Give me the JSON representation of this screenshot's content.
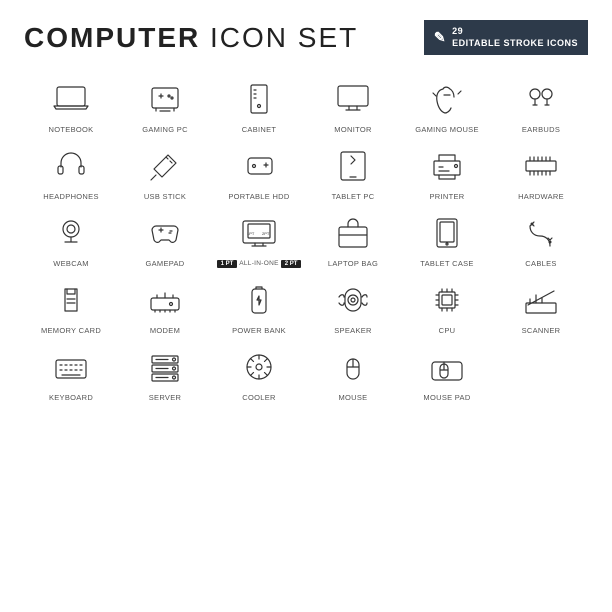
{
  "header": {
    "title_part1": "COMPUTER",
    "title_part2": "ICON SET",
    "badge_count": "29",
    "badge_text": "EDITABLE STROKE ICONS"
  },
  "icons": [
    {
      "id": "notebook",
      "label": "NOTEBOOK"
    },
    {
      "id": "gaming-pc",
      "label": "GAMING PC"
    },
    {
      "id": "cabinet",
      "label": "CABINET"
    },
    {
      "id": "monitor",
      "label": "MONITOR"
    },
    {
      "id": "gaming-mouse",
      "label": "GAMING MOUSE"
    },
    {
      "id": "earbuds",
      "label": "EARBUDS"
    },
    {
      "id": "headphones",
      "label": "HEADPHONES"
    },
    {
      "id": "usb-stick",
      "label": "USB STICK"
    },
    {
      "id": "portable-hdd",
      "label": "PORTABLE HDD"
    },
    {
      "id": "tablet-pc",
      "label": "TABLET PC"
    },
    {
      "id": "printer",
      "label": "PRINTER"
    },
    {
      "id": "hardware",
      "label": "HARDWARE"
    },
    {
      "id": "webcam",
      "label": "WEBCAM"
    },
    {
      "id": "gamepad",
      "label": "GAMEPAD"
    },
    {
      "id": "all-in-one",
      "label": "ALL-IN-ONE"
    },
    {
      "id": "laptop-bag",
      "label": "LAPTOP BAG"
    },
    {
      "id": "tablet-case",
      "label": "TABLET CASE"
    },
    {
      "id": "cables",
      "label": "CABLES"
    },
    {
      "id": "memory-card",
      "label": "MEMORY CARD"
    },
    {
      "id": "modem",
      "label": "MODEM"
    },
    {
      "id": "power-bank",
      "label": "POWER BANK"
    },
    {
      "id": "speaker",
      "label": "SPEAKER"
    },
    {
      "id": "cpu",
      "label": "CPU"
    },
    {
      "id": "scanner",
      "label": "SCANNER"
    },
    {
      "id": "keyboard",
      "label": "KEYBOARD"
    },
    {
      "id": "server",
      "label": "SERVER"
    },
    {
      "id": "cooler",
      "label": "COOLER"
    },
    {
      "id": "mouse",
      "label": "MOUSE"
    },
    {
      "id": "mouse-pad",
      "label": "MOUSE PAD"
    }
  ]
}
